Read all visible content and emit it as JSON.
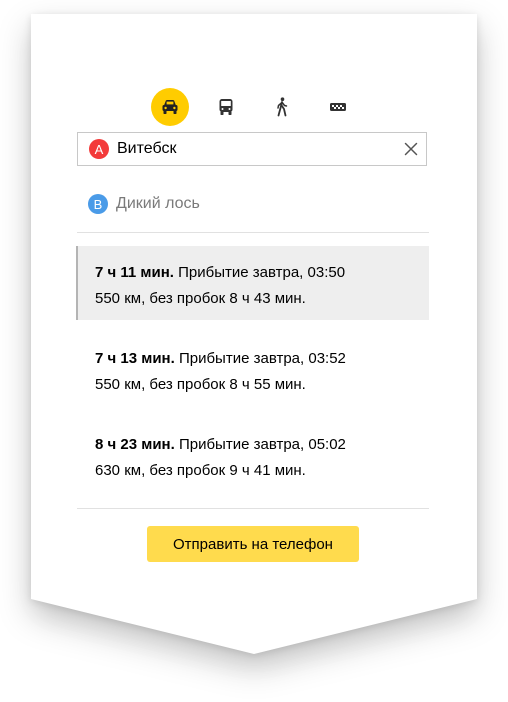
{
  "modes": [
    {
      "icon": "car-icon",
      "active": true
    },
    {
      "icon": "bus-icon",
      "active": false
    },
    {
      "icon": "pedestrian-icon",
      "active": false
    },
    {
      "icon": "taxi-icon",
      "active": false
    }
  ],
  "origin": {
    "marker": "A",
    "value": "Витебск"
  },
  "destination": {
    "marker": "B",
    "value": "Дикий лось"
  },
  "routes": [
    {
      "duration": "7 ч 11 мин.",
      "arrival": " Прибытие завтра, 03:50",
      "details": "550 км, без пробок 8 ч 43 мин.",
      "selected": true
    },
    {
      "duration": "7 ч 13 мин.",
      "arrival": " Прибытие завтра, 03:52",
      "details": "550 км, без пробок 8 ч 55 мин.",
      "selected": false
    },
    {
      "duration": "8 ч 23 мин.",
      "arrival": " Прибытие завтра, 05:02",
      "details": "630 км, без пробок 9 ч 41 мин.",
      "selected": false
    }
  ],
  "send_button": {
    "label": "Отправить на телефон"
  },
  "colors": {
    "accent": "#ffcc00",
    "button": "#ffdb4d",
    "marker_a": "#f33a3a",
    "marker_b": "#4a9be8"
  }
}
